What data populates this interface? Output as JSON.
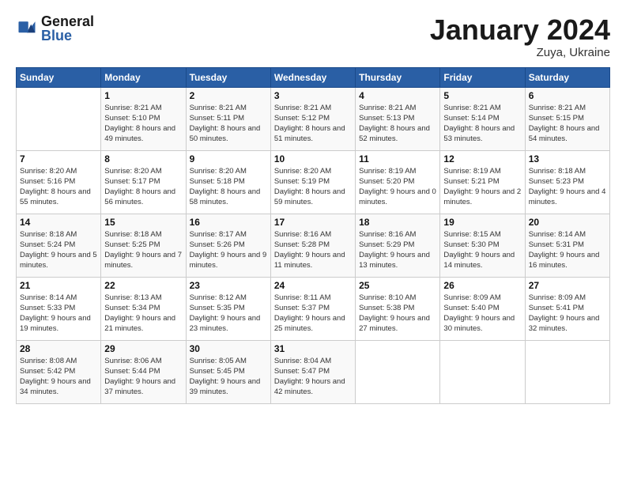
{
  "header": {
    "logo_general": "General",
    "logo_blue": "Blue",
    "month_title": "January 2024",
    "location": "Zuya, Ukraine"
  },
  "days_of_week": [
    "Sunday",
    "Monday",
    "Tuesday",
    "Wednesday",
    "Thursday",
    "Friday",
    "Saturday"
  ],
  "weeks": [
    [
      {
        "day": "",
        "sunrise": "",
        "sunset": "",
        "daylight": ""
      },
      {
        "day": "1",
        "sunrise": "Sunrise: 8:21 AM",
        "sunset": "Sunset: 5:10 PM",
        "daylight": "Daylight: 8 hours and 49 minutes."
      },
      {
        "day": "2",
        "sunrise": "Sunrise: 8:21 AM",
        "sunset": "Sunset: 5:11 PM",
        "daylight": "Daylight: 8 hours and 50 minutes."
      },
      {
        "day": "3",
        "sunrise": "Sunrise: 8:21 AM",
        "sunset": "Sunset: 5:12 PM",
        "daylight": "Daylight: 8 hours and 51 minutes."
      },
      {
        "day": "4",
        "sunrise": "Sunrise: 8:21 AM",
        "sunset": "Sunset: 5:13 PM",
        "daylight": "Daylight: 8 hours and 52 minutes."
      },
      {
        "day": "5",
        "sunrise": "Sunrise: 8:21 AM",
        "sunset": "Sunset: 5:14 PM",
        "daylight": "Daylight: 8 hours and 53 minutes."
      },
      {
        "day": "6",
        "sunrise": "Sunrise: 8:21 AM",
        "sunset": "Sunset: 5:15 PM",
        "daylight": "Daylight: 8 hours and 54 minutes."
      }
    ],
    [
      {
        "day": "7",
        "sunrise": "Sunrise: 8:20 AM",
        "sunset": "Sunset: 5:16 PM",
        "daylight": "Daylight: 8 hours and 55 minutes."
      },
      {
        "day": "8",
        "sunrise": "Sunrise: 8:20 AM",
        "sunset": "Sunset: 5:17 PM",
        "daylight": "Daylight: 8 hours and 56 minutes."
      },
      {
        "day": "9",
        "sunrise": "Sunrise: 8:20 AM",
        "sunset": "Sunset: 5:18 PM",
        "daylight": "Daylight: 8 hours and 58 minutes."
      },
      {
        "day": "10",
        "sunrise": "Sunrise: 8:20 AM",
        "sunset": "Sunset: 5:19 PM",
        "daylight": "Daylight: 8 hours and 59 minutes."
      },
      {
        "day": "11",
        "sunrise": "Sunrise: 8:19 AM",
        "sunset": "Sunset: 5:20 PM",
        "daylight": "Daylight: 9 hours and 0 minutes."
      },
      {
        "day": "12",
        "sunrise": "Sunrise: 8:19 AM",
        "sunset": "Sunset: 5:21 PM",
        "daylight": "Daylight: 9 hours and 2 minutes."
      },
      {
        "day": "13",
        "sunrise": "Sunrise: 8:18 AM",
        "sunset": "Sunset: 5:23 PM",
        "daylight": "Daylight: 9 hours and 4 minutes."
      }
    ],
    [
      {
        "day": "14",
        "sunrise": "Sunrise: 8:18 AM",
        "sunset": "Sunset: 5:24 PM",
        "daylight": "Daylight: 9 hours and 5 minutes."
      },
      {
        "day": "15",
        "sunrise": "Sunrise: 8:18 AM",
        "sunset": "Sunset: 5:25 PM",
        "daylight": "Daylight: 9 hours and 7 minutes."
      },
      {
        "day": "16",
        "sunrise": "Sunrise: 8:17 AM",
        "sunset": "Sunset: 5:26 PM",
        "daylight": "Daylight: 9 hours and 9 minutes."
      },
      {
        "day": "17",
        "sunrise": "Sunrise: 8:16 AM",
        "sunset": "Sunset: 5:28 PM",
        "daylight": "Daylight: 9 hours and 11 minutes."
      },
      {
        "day": "18",
        "sunrise": "Sunrise: 8:16 AM",
        "sunset": "Sunset: 5:29 PM",
        "daylight": "Daylight: 9 hours and 13 minutes."
      },
      {
        "day": "19",
        "sunrise": "Sunrise: 8:15 AM",
        "sunset": "Sunset: 5:30 PM",
        "daylight": "Daylight: 9 hours and 14 minutes."
      },
      {
        "day": "20",
        "sunrise": "Sunrise: 8:14 AM",
        "sunset": "Sunset: 5:31 PM",
        "daylight": "Daylight: 9 hours and 16 minutes."
      }
    ],
    [
      {
        "day": "21",
        "sunrise": "Sunrise: 8:14 AM",
        "sunset": "Sunset: 5:33 PM",
        "daylight": "Daylight: 9 hours and 19 minutes."
      },
      {
        "day": "22",
        "sunrise": "Sunrise: 8:13 AM",
        "sunset": "Sunset: 5:34 PM",
        "daylight": "Daylight: 9 hours and 21 minutes."
      },
      {
        "day": "23",
        "sunrise": "Sunrise: 8:12 AM",
        "sunset": "Sunset: 5:35 PM",
        "daylight": "Daylight: 9 hours and 23 minutes."
      },
      {
        "day": "24",
        "sunrise": "Sunrise: 8:11 AM",
        "sunset": "Sunset: 5:37 PM",
        "daylight": "Daylight: 9 hours and 25 minutes."
      },
      {
        "day": "25",
        "sunrise": "Sunrise: 8:10 AM",
        "sunset": "Sunset: 5:38 PM",
        "daylight": "Daylight: 9 hours and 27 minutes."
      },
      {
        "day": "26",
        "sunrise": "Sunrise: 8:09 AM",
        "sunset": "Sunset: 5:40 PM",
        "daylight": "Daylight: 9 hours and 30 minutes."
      },
      {
        "day": "27",
        "sunrise": "Sunrise: 8:09 AM",
        "sunset": "Sunset: 5:41 PM",
        "daylight": "Daylight: 9 hours and 32 minutes."
      }
    ],
    [
      {
        "day": "28",
        "sunrise": "Sunrise: 8:08 AM",
        "sunset": "Sunset: 5:42 PM",
        "daylight": "Daylight: 9 hours and 34 minutes."
      },
      {
        "day": "29",
        "sunrise": "Sunrise: 8:06 AM",
        "sunset": "Sunset: 5:44 PM",
        "daylight": "Daylight: 9 hours and 37 minutes."
      },
      {
        "day": "30",
        "sunrise": "Sunrise: 8:05 AM",
        "sunset": "Sunset: 5:45 PM",
        "daylight": "Daylight: 9 hours and 39 minutes."
      },
      {
        "day": "31",
        "sunrise": "Sunrise: 8:04 AM",
        "sunset": "Sunset: 5:47 PM",
        "daylight": "Daylight: 9 hours and 42 minutes."
      },
      {
        "day": "",
        "sunrise": "",
        "sunset": "",
        "daylight": ""
      },
      {
        "day": "",
        "sunrise": "",
        "sunset": "",
        "daylight": ""
      },
      {
        "day": "",
        "sunrise": "",
        "sunset": "",
        "daylight": ""
      }
    ]
  ]
}
